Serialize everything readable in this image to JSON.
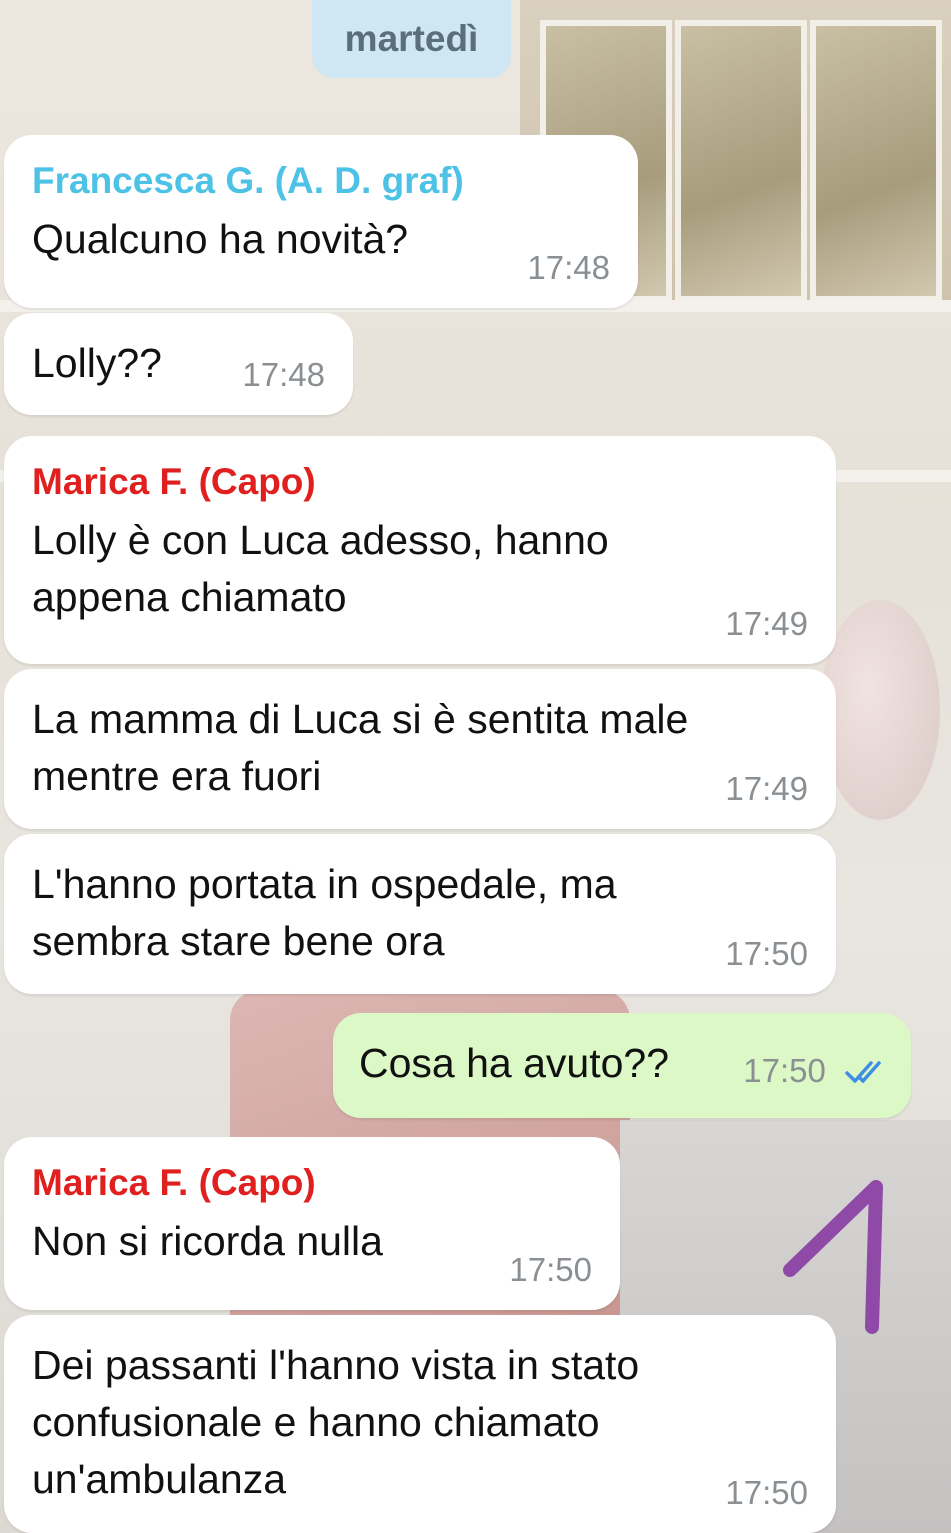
{
  "date_separator": "martedì",
  "messages": [
    {
      "sender": "Francesca G. (A. D. graf)",
      "text": "Qualcuno ha novità?",
      "time": "17:48"
    },
    {
      "sender": "",
      "text": "Lolly??",
      "time": "17:48"
    },
    {
      "sender": "Marica F. (Capo)",
      "text": "Lolly è con Luca adesso, hanno appena chiamato",
      "time": "17:49"
    },
    {
      "sender": "",
      "text": "La mamma di Luca si è sentita male mentre era fuori",
      "time": "17:49"
    },
    {
      "sender": "",
      "text": "L'hanno portata in ospedale, ma sembra stare bene ora",
      "time": "17:50"
    },
    {
      "sender": "",
      "text": "Cosa ha avuto??",
      "time": "17:50",
      "outgoing": true,
      "status": "read"
    },
    {
      "sender": "Marica F. (Capo)",
      "text": "Non si ricorda nulla",
      "time": "17:50"
    },
    {
      "sender": "",
      "text": "Dei passanti l'hanno vista in stato confusionale e hanno chiamato un'ambulanza",
      "time": "17:50"
    }
  ],
  "annotation": {
    "label": "1",
    "color": "#8e4aa6"
  },
  "colors": {
    "incoming": "#ffffff",
    "outgoing": "#dcf8c6",
    "sender_cyan": "#4cc2e6",
    "sender_red": "#e01f1f",
    "read_ticks": "#3f8ee6"
  }
}
